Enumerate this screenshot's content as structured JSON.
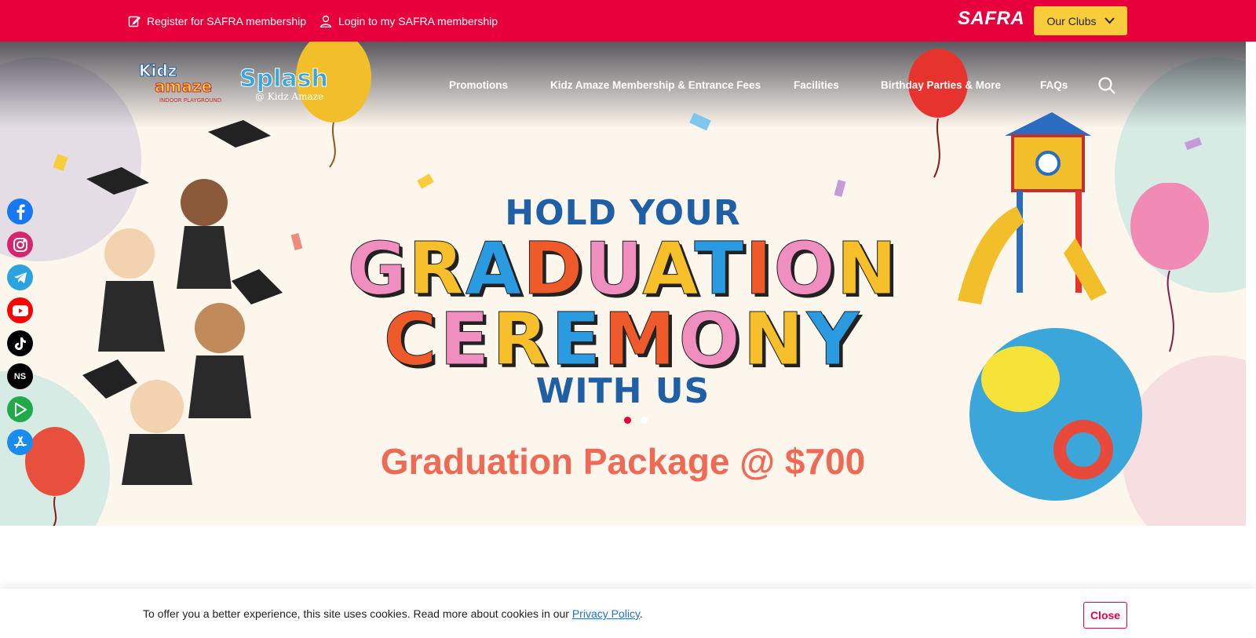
{
  "topbar": {
    "register_label": "Register for SAFRA membership",
    "login_label": "Login to my SAFRA membership",
    "brand": "SAFRA",
    "clubs_label": "Our Clubs",
    "bg_color": "#e8003d",
    "clubs_color": "#f7cd3c"
  },
  "nav": {
    "items": [
      {
        "label": "Promotions"
      },
      {
        "label": "Kidz Amaze Membership & Entrance Fees"
      },
      {
        "label": "Facilities"
      },
      {
        "label": "Birthday Parties & More"
      },
      {
        "label": "FAQs"
      }
    ]
  },
  "logo": {
    "brand_1": "Kidz amaze",
    "brand_2": "Splash",
    "brand_2_sub": "@ Kidz Amaze",
    "tagline": "INDOOR PLAYGROUND"
  },
  "social": [
    "facebook-icon",
    "instagram-icon",
    "telegram-icon",
    "youtube-icon",
    "tiktok-icon",
    "ns-icon",
    "google-play-icon",
    "app-store-icon"
  ],
  "social_ns_text": "NS",
  "hero": {
    "line1": "HOLD YOUR",
    "line2": "GRADUATION",
    "line3": "CEREMONY",
    "line4": "WITH US",
    "package": "Graduation Package @ $700",
    "slides": 2,
    "active_slide": 1
  },
  "cookie": {
    "text_before": "To offer you a better experience, this site uses cookies. Read more about cookies in our ",
    "link": "Privacy Policy",
    "text_after": ".",
    "close_label": "Close"
  }
}
